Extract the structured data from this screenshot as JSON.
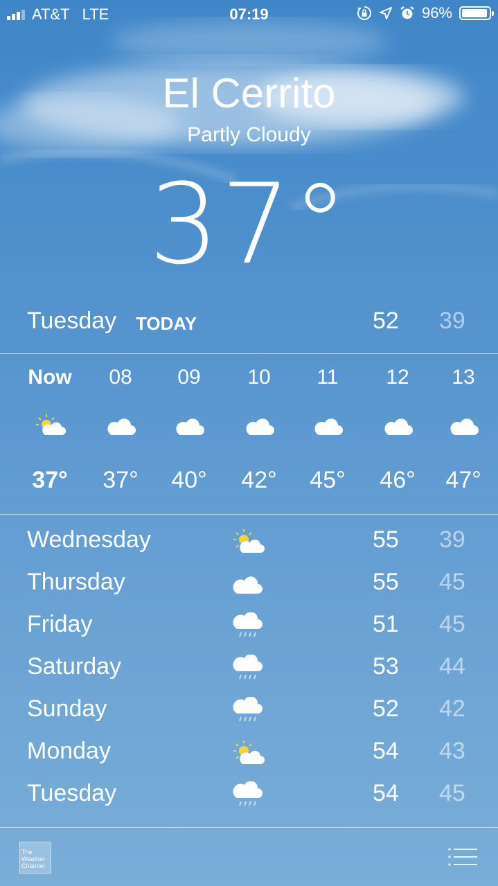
{
  "status_bar": {
    "carrier": "AT&T",
    "network": "LTE",
    "time": "07:19",
    "battery": "96%",
    "battery_level": 0.96,
    "icons": [
      "signal-icon",
      "orientation-lock-icon",
      "location-icon",
      "alarm-icon",
      "battery-icon"
    ]
  },
  "location": {
    "city": "El Cerrito",
    "condition": "Partly Cloudy",
    "temperature": "37°"
  },
  "today": {
    "day": "Tuesday",
    "tag": "TODAY",
    "high": "52",
    "low": "39"
  },
  "hourly": [
    {
      "time": "Now",
      "icon": "partly-cloudy-icon",
      "temp": "37°"
    },
    {
      "time": "08",
      "icon": "cloud-icon",
      "temp": "37°"
    },
    {
      "time": "09",
      "icon": "cloud-icon",
      "temp": "40°"
    },
    {
      "time": "10",
      "icon": "cloud-icon",
      "temp": "42°"
    },
    {
      "time": "11",
      "icon": "cloud-icon",
      "temp": "45°"
    },
    {
      "time": "12",
      "icon": "cloud-icon",
      "temp": "46°"
    },
    {
      "time": "13",
      "icon": "cloud-icon",
      "temp": "47°"
    }
  ],
  "daily": [
    {
      "day": "Wednesday",
      "icon": "partly-cloudy-icon",
      "high": "55",
      "low": "39"
    },
    {
      "day": "Thursday",
      "icon": "cloud-icon",
      "high": "55",
      "low": "45"
    },
    {
      "day": "Friday",
      "icon": "rain-icon",
      "high": "51",
      "low": "45"
    },
    {
      "day": "Saturday",
      "icon": "rain-icon",
      "high": "53",
      "low": "44"
    },
    {
      "day": "Sunday",
      "icon": "rain-icon",
      "high": "52",
      "low": "42"
    },
    {
      "day": "Monday",
      "icon": "partly-cloudy-icon",
      "high": "54",
      "low": "43"
    },
    {
      "day": "Tuesday",
      "icon": "rain-icon",
      "high": "54",
      "low": "45"
    }
  ],
  "footer": {
    "logo_text": "The Weather Channel",
    "list_icon": "list-icon"
  },
  "colors": {
    "sky_top": "#3f86c8",
    "sky_bottom": "#7aaed8",
    "sun": "#f6d33c",
    "low_temp": "rgba(255,255,255,0.55)"
  }
}
